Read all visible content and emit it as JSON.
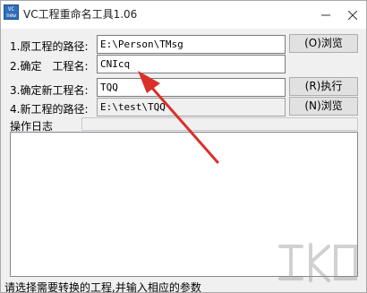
{
  "window": {
    "title": "VC工程重命名工具1.06",
    "icon_text_top": "VC",
    "icon_text_bottom": "new",
    "controls": {
      "minimize_icon": "minimize-icon",
      "close_icon": "close-icon"
    }
  },
  "rows": [
    {
      "label": "1.原工程的路径:",
      "value": "E:\\Person\\TMsg",
      "button": "(O)浏览"
    },
    {
      "label": "2.确定　工程名:",
      "value": "CNIcq"
    },
    {
      "label": "3.确定新工程名:",
      "value": "TQQ",
      "button": "(R)执行"
    },
    {
      "label": "4.新工程的路径:",
      "value": "E:\\test\\TQQ",
      "button": "(N)浏览"
    }
  ],
  "log": {
    "label": "操作日志",
    "content": ""
  },
  "status": {
    "text": "请选择需要转换的工程,并输入相应的参数"
  },
  "colors": {
    "arrow": "#d9302a",
    "icon_bg": "#2f6fb8",
    "window_bg": "#f0f0f0"
  }
}
